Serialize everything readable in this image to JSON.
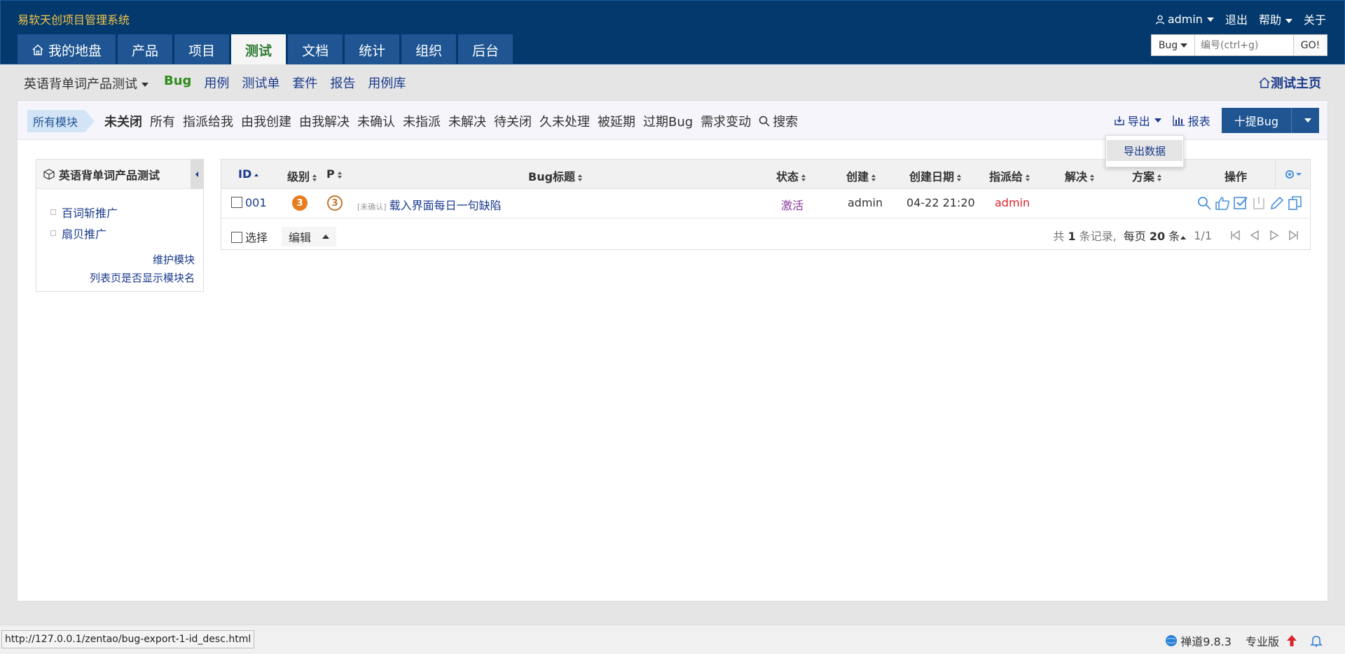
{
  "app": {
    "title": "易软天创项目管理系统"
  },
  "topbar": {
    "user": "admin",
    "logout": "退出",
    "help": "帮助",
    "about": "关于"
  },
  "mainnav": {
    "tabs": [
      {
        "label": "我的地盘"
      },
      {
        "label": "产品"
      },
      {
        "label": "项目"
      },
      {
        "label": "测试"
      },
      {
        "label": "文档"
      },
      {
        "label": "统计"
      },
      {
        "label": "组织"
      },
      {
        "label": "后台"
      }
    ]
  },
  "search": {
    "type": "Bug",
    "placeholder": "编号(ctrl+g)",
    "go": "GO!"
  },
  "subnav": {
    "product": "英语背单词产品测试",
    "items": [
      "Bug",
      "用例",
      "测试单",
      "套件",
      "报告",
      "用例库"
    ],
    "home": "测试主页"
  },
  "featurebar": {
    "module": "所有模块",
    "filters": [
      "未关闭",
      "所有",
      "指派给我",
      "由我创建",
      "由我解决",
      "未确认",
      "未指派",
      "未解决",
      "待关闭",
      "久未处理",
      "被延期",
      "过期Bug",
      "需求变动"
    ],
    "search": "搜索",
    "export": "导出",
    "report": "报表",
    "create_bug": "十提Bug",
    "export_menu_item": "导出数据"
  },
  "side": {
    "title": "英语背单词产品测试",
    "modules": [
      "百词斩推广",
      "扇贝推广"
    ],
    "maintain": "维护模块",
    "show_module_name": "列表页是否显示模块名"
  },
  "table": {
    "headers": {
      "id": "ID",
      "severity": "级别",
      "pri": "P",
      "title": "Bug标题",
      "status": "状态",
      "creator": "创建",
      "created_date": "创建日期",
      "assigned_to": "指派给",
      "resolved_by": "解决",
      "resolution": "方案",
      "actions": "操作"
    },
    "rows": [
      {
        "id": "001",
        "severity": "3",
        "pri": "3",
        "confirm": "[未确认]",
        "title": "载入界面每日一句缺陷",
        "status": "激活",
        "creator": "admin",
        "created_date": "04-22 21:20",
        "assigned_to": "admin"
      }
    ],
    "footer": {
      "select": "选择",
      "edit": "编辑",
      "total_pre": "共",
      "total": "1",
      "total_post": "条记录,",
      "per_page_pre": "每页",
      "per_page": "20",
      "per_page_post": "条",
      "page": "1/1"
    }
  },
  "statusbar": {
    "url": "http://127.0.0.1/zentao/bug-export-1-id_desc.html",
    "version": "禅道9.8.3",
    "edition": "专业版"
  },
  "colors": {
    "header_bg": "#03396c",
    "accent": "#1e5592",
    "title_yellow": "#f5c54a",
    "active_green": "#2e8b1a",
    "status_purple": "#8a3a9a",
    "assigned_red": "#d9232d"
  }
}
